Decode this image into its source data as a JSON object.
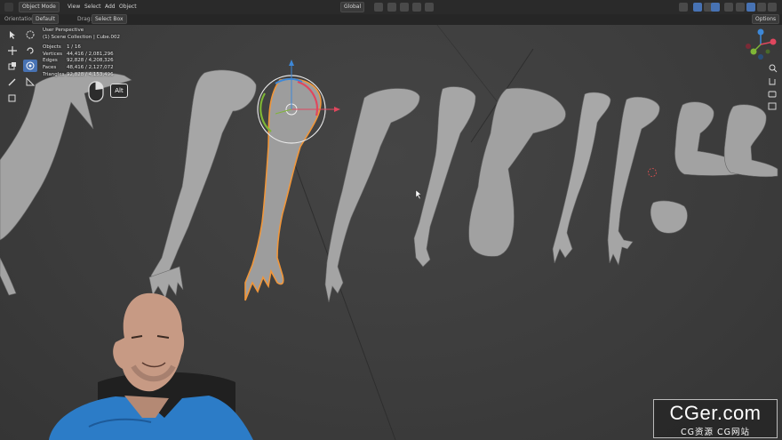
{
  "header": {
    "mode": "Object Mode",
    "menus": [
      "View",
      "Select",
      "Add",
      "Object"
    ],
    "transform_orientation": "Global",
    "options": "Options"
  },
  "tool_settings": {
    "orientation_label": "Orientation:",
    "orientation_value": "Default",
    "drag_label": "Drag:",
    "drag_value": "Select Box"
  },
  "overlay": {
    "view_name": "User Perspective",
    "collection": "(1) Scene Collection | Cube.002",
    "stats": [
      {
        "label": "Objects",
        "value": "1 / 16"
      },
      {
        "label": "Vertices",
        "value": "44,416 / 2,081,296"
      },
      {
        "label": "Edges",
        "value": "92,828 / 4,208,326"
      },
      {
        "label": "Faces",
        "value": "48,416 / 2,127,072"
      },
      {
        "label": "Triangles",
        "value": "92,828 / 4,153,496"
      }
    ]
  },
  "hint": {
    "key": "Alt"
  },
  "navigation_gizmo": {
    "axes": [
      "X",
      "Y",
      "Z"
    ],
    "colors": {
      "x": "#e0475e",
      "y": "#7fb636",
      "z": "#3d88d8"
    }
  },
  "colors": {
    "accent": "#4772b3",
    "selection_outline": "#f0963a",
    "viewport_bg": "#3d3d3d"
  },
  "watermark": {
    "main": "CGer.com",
    "sub": "CG资源 CG网站"
  }
}
